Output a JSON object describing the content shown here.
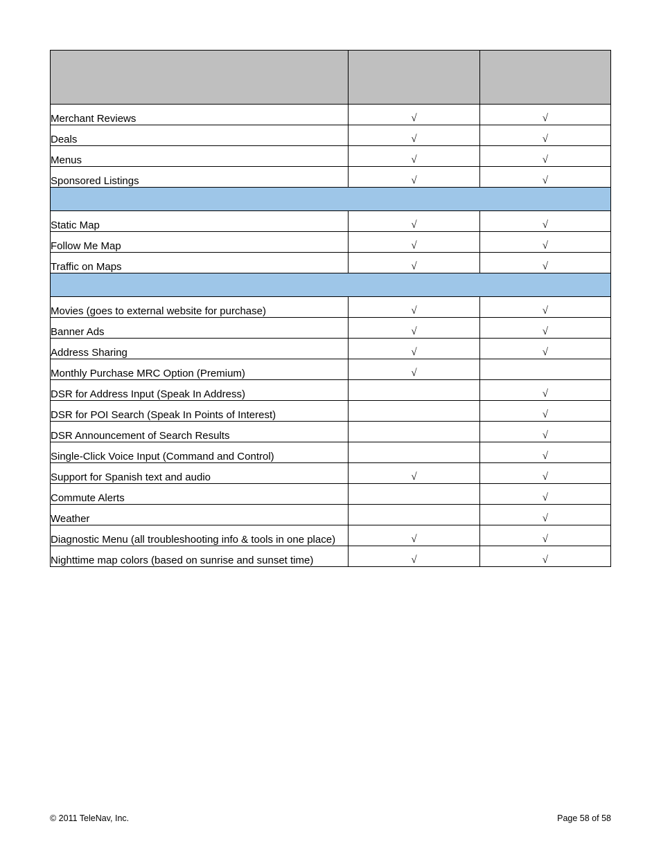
{
  "check_symbol": "√",
  "sections": [
    {
      "type": "header"
    },
    {
      "type": "rows",
      "rows": [
        {
          "label": "Merchant Reviews",
          "col1": true,
          "col2": true
        },
        {
          "label": "Deals",
          "col1": true,
          "col2": true
        },
        {
          "label": "Menus",
          "col1": true,
          "col2": true
        },
        {
          "label": "Sponsored Listings",
          "col1": true,
          "col2": true
        }
      ]
    },
    {
      "type": "section_header"
    },
    {
      "type": "rows",
      "rows": [
        {
          "label": "Static Map",
          "col1": true,
          "col2": true
        },
        {
          "label": "Follow Me Map",
          "col1": true,
          "col2": true
        },
        {
          "label": "Traffic on Maps",
          "col1": true,
          "col2": true
        }
      ]
    },
    {
      "type": "section_header"
    },
    {
      "type": "rows",
      "rows": [
        {
          "label": "Movies (goes to external website for purchase)",
          "col1": true,
          "col2": true
        },
        {
          "label": "Banner Ads",
          "col1": true,
          "col2": true
        },
        {
          "label": "Address Sharing",
          "col1": true,
          "col2": true
        },
        {
          "label": "Monthly Purchase MRC Option (Premium)",
          "col1": true,
          "col2": false
        },
        {
          "label": "DSR for Address Input (Speak In Address)",
          "col1": false,
          "col2": true
        },
        {
          "label": "DSR for POI Search (Speak In Points of Interest)",
          "col1": false,
          "col2": true
        },
        {
          "label": "DSR Announcement of Search Results",
          "col1": false,
          "col2": true
        },
        {
          "label": "Single-Click Voice Input (Command and Control)",
          "col1": false,
          "col2": true
        },
        {
          "label": "Support for Spanish text and audio",
          "col1": true,
          "col2": true
        },
        {
          "label": "Commute Alerts",
          "col1": false,
          "col2": true
        },
        {
          "label": "Weather",
          "col1": false,
          "col2": true
        },
        {
          "label": "Diagnostic Menu (all troubleshooting info & tools in one place)",
          "col1": true,
          "col2": true
        },
        {
          "label": "Nighttime map colors (based on sunrise and sunset time)",
          "col1": true,
          "col2": true
        }
      ]
    }
  ],
  "footer": {
    "copyright": "© 2011 TeleNav, Inc.",
    "page": "Page 58 of 58"
  }
}
